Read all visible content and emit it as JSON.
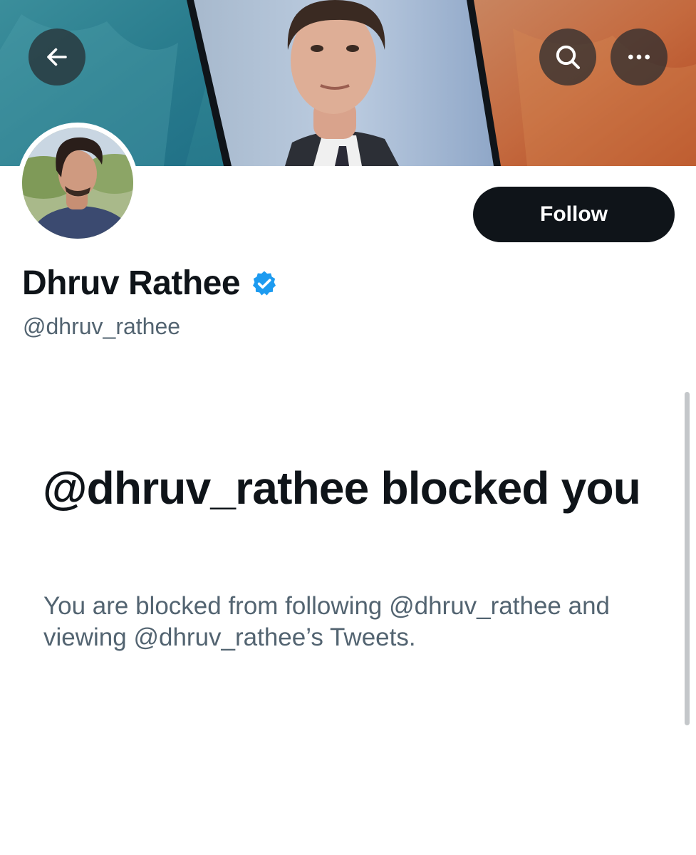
{
  "header": {
    "back_icon": "arrow-left-icon",
    "search_icon": "search-icon",
    "more_icon": "more-horizontal-icon"
  },
  "profile": {
    "display_name": "Dhruv Rathee",
    "verified_icon": "verified-badge-icon",
    "handle": "@dhruv_rathee",
    "follow_label": "Follow"
  },
  "blocked": {
    "title": "@dhruv_rathee blocked you",
    "description": "You are blocked from following @dhruv_rathee and viewing @dhruv_rathee’s Tweets."
  },
  "colors": {
    "text_primary": "#0f1419",
    "text_secondary": "#536471",
    "verified_blue": "#1d9bf0",
    "button_dark": "#0f1419"
  }
}
